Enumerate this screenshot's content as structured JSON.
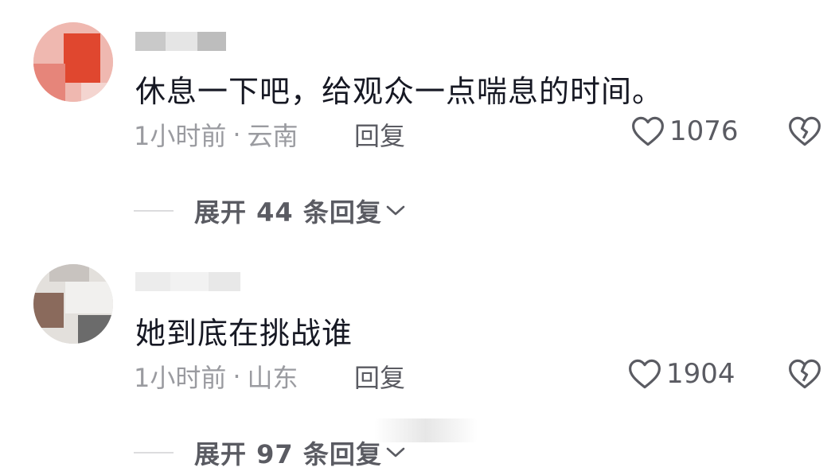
{
  "comments": [
    {
      "text": "休息一下吧，给观众一点喘息的时间。",
      "time": "1小时前",
      "separator": "·",
      "location": "云南",
      "reply_label": "回复",
      "likes": "1076",
      "expand_label": "展开 44 条回复"
    },
    {
      "text": "她到底在挑战谁",
      "time": "1小时前",
      "separator": "·",
      "location": "山东",
      "reply_label": "回复",
      "likes": "1904",
      "expand_label": "展开 97 条回复"
    }
  ],
  "icons": {
    "like": "heart-outline-icon",
    "dislike": "broken-heart-icon",
    "expand": "chevron-down-icon"
  },
  "colors": {
    "text": "#161823",
    "meta": "#9a9ba0",
    "action": "#5a5b62"
  }
}
